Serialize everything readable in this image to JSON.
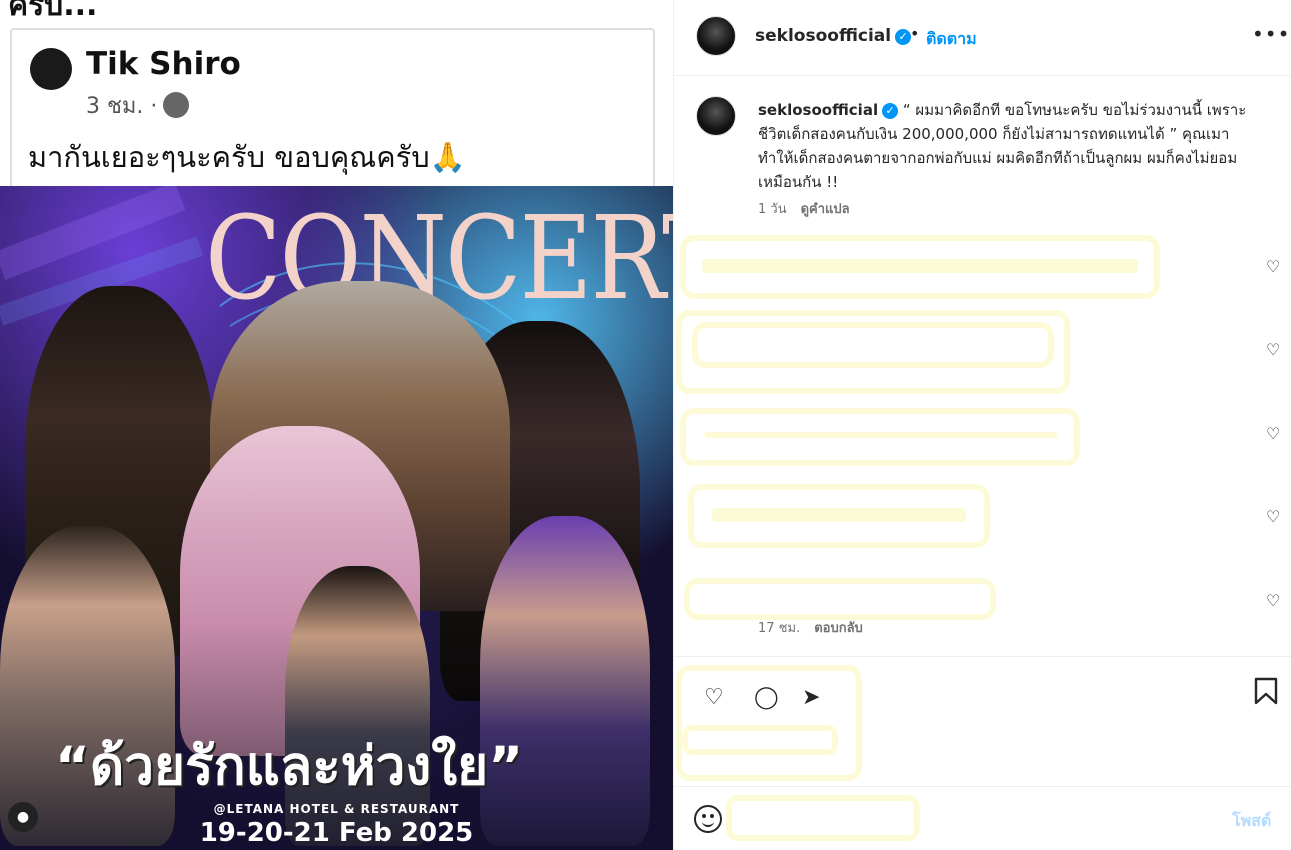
{
  "fb": {
    "top_text": "ครับ...",
    "name": "Tik Shiro",
    "time": "3 ชม. ·",
    "text": "มากันเยอะๆนะครับ ขอบคุณครับ🙏"
  },
  "poster": {
    "title": "CONCERT",
    "subtitle": "“ด้วยรักและห่วงใย”",
    "venue": "@LETANA HOTEL & RESTAURANT",
    "date": "19-20-21 Feb 2025"
  },
  "header": {
    "username": "seklosoofficial",
    "dot": "•",
    "follow_label": "ติดตาม",
    "more": "•••"
  },
  "caption": {
    "username": "seklosoofficial",
    "text": " “ ผมมาคิดอีกที ขอโทษนะครับ ขอไม่ร่วมงานนี้ เพราะชีวิตเด็กสองคนกับเงิน 200,000,000 ก็ยังไม่สามารถทดแทนได้ ” คุณเมาทำให้เด็กสองคนตายจากอกพ่อกับแม่ ผมคิดอีกทีถ้าเป็นลูกผม ผมก็คงไม่ยอมเหมือนกัน !!",
    "time": "1 วัน",
    "translate": "ดูคำแปล"
  },
  "last_comment": {
    "time": "17 ชม.",
    "reply": "ตอบกลับ"
  },
  "compose": {
    "placeholder": "",
    "post_label": "โพสต์"
  },
  "icons": {
    "verified": "verified-badge-icon",
    "heart": "heart-icon",
    "bookmark": "bookmark-icon",
    "emoji": "emoji-icon",
    "more": "more-options-icon",
    "user_tag": "user-tag-icon"
  },
  "colors": {
    "accent": "#0095f6",
    "post_disabled": "#b3dbff",
    "redaction": "#fdfbd7"
  }
}
